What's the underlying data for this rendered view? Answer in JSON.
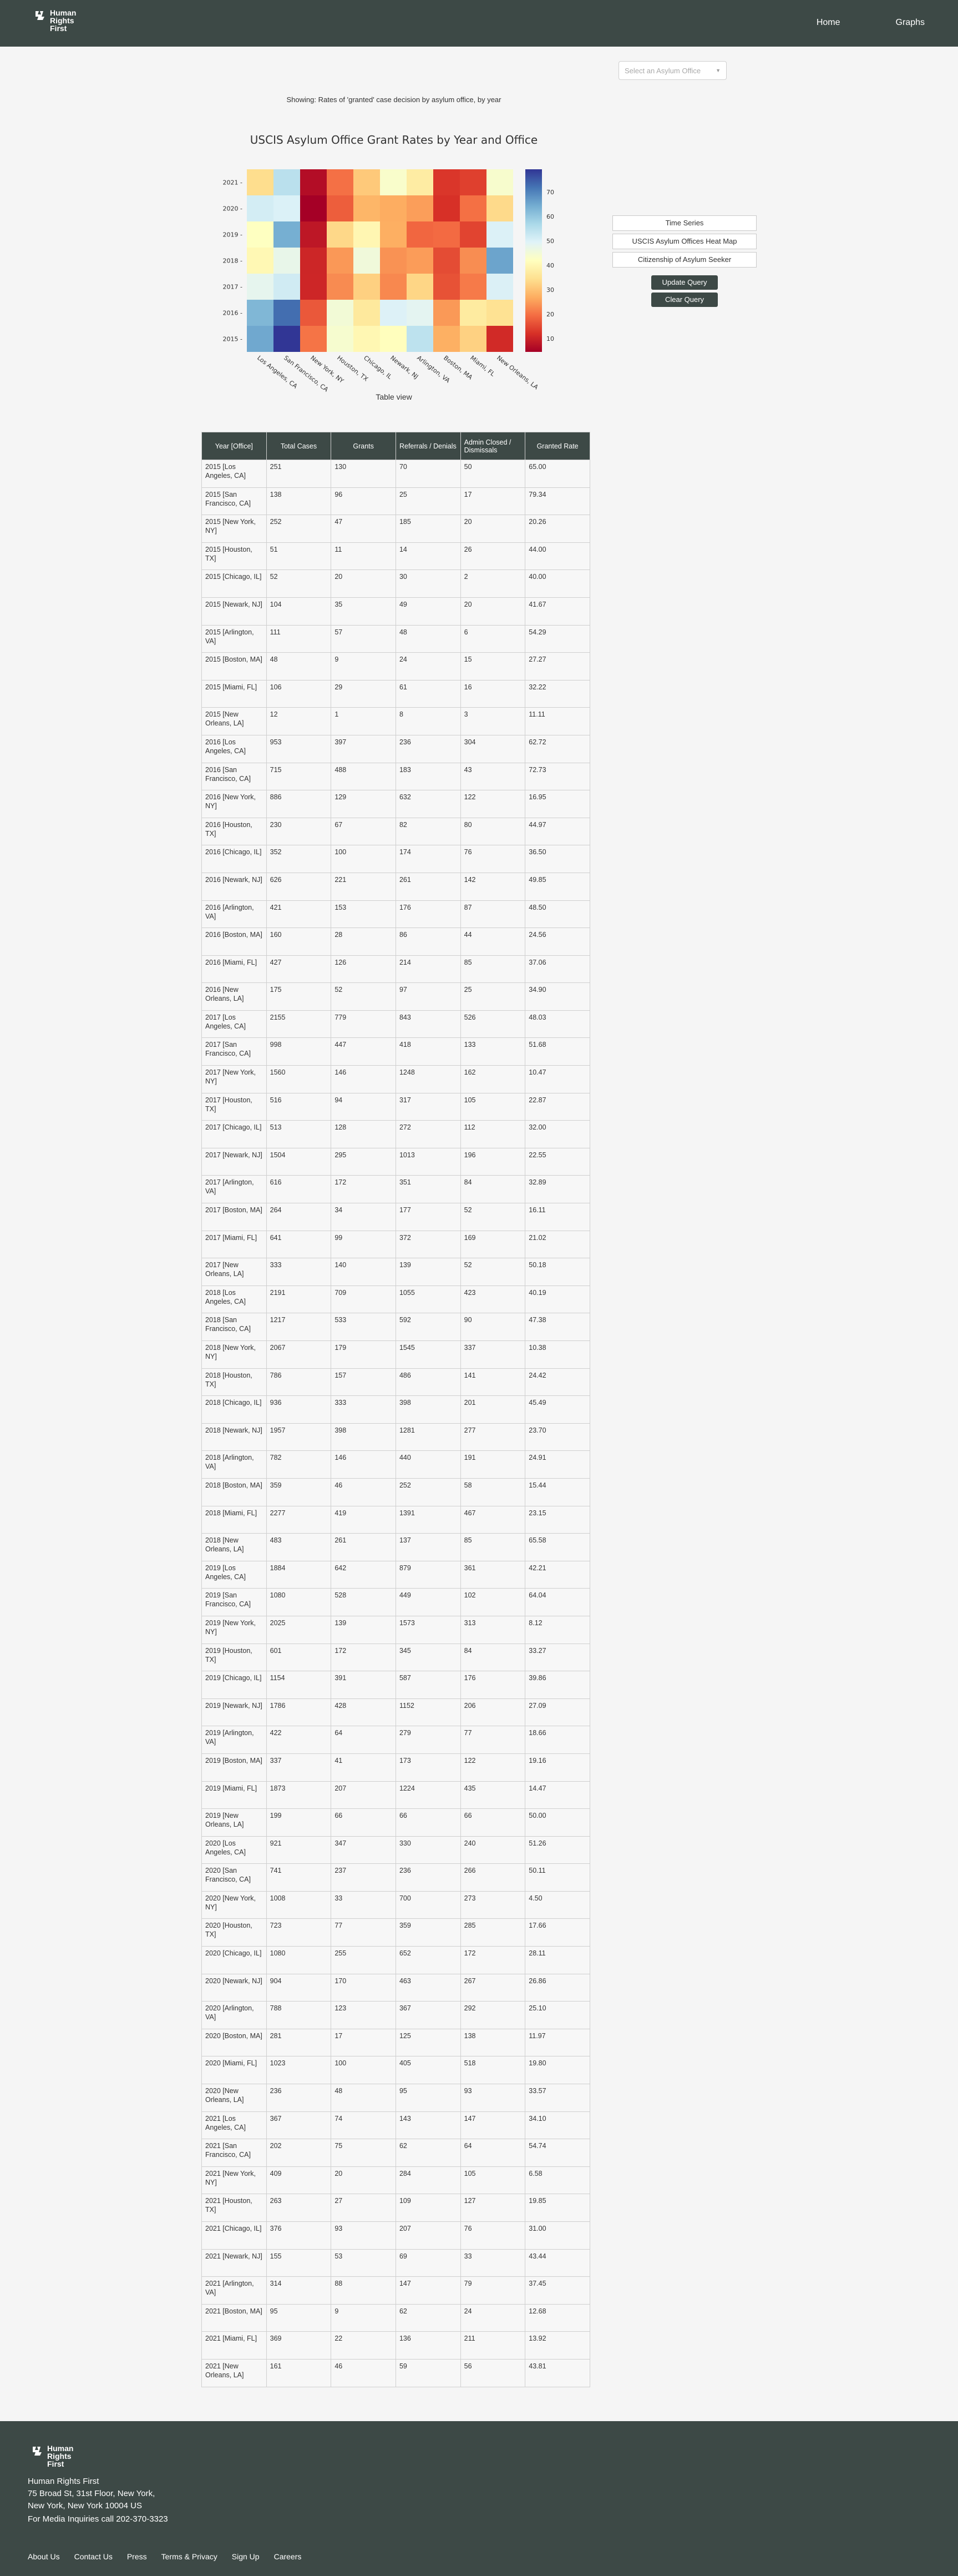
{
  "header": {
    "logo_lines": [
      "Human",
      "Rights",
      "First"
    ],
    "nav": [
      {
        "label": "Home"
      },
      {
        "label": "Graphs"
      }
    ]
  },
  "office_select": {
    "placeholder": "Select an Asylum Office"
  },
  "showing_text": "Showing: Rates of 'granted' case decision by asylum office, by year",
  "side_panel": {
    "options": [
      {
        "label": "Time Series"
      },
      {
        "label": "USCIS Asylum Offices Heat Map"
      },
      {
        "label": "Citizenship of Asylum Seeker"
      }
    ],
    "update_label": "Update Query",
    "clear_label": "Clear Query"
  },
  "table_view_label": "Table view",
  "chart_data": {
    "type": "heatmap",
    "title": "USCIS Asylum Office Grant Rates by Year and Office",
    "x_categories": [
      "Los Angeles, CA",
      "San Francisco, CA",
      "New York, NY",
      "Houston, TX",
      "Chicago, IL",
      "Newark, NJ",
      "Arlington, VA",
      "Boston, MA",
      "Miami, FL",
      "New Orleans, LA"
    ],
    "y_categories": [
      "2021",
      "2020",
      "2019",
      "2018",
      "2017",
      "2016",
      "2015"
    ],
    "values": [
      [
        34.1,
        54.74,
        6.58,
        19.85,
        31.0,
        43.44,
        37.45,
        12.68,
        13.92,
        43.81
      ],
      [
        51.26,
        50.11,
        4.5,
        17.66,
        28.11,
        26.86,
        25.1,
        11.97,
        19.8,
        33.57
      ],
      [
        42.21,
        64.04,
        8.12,
        33.27,
        39.86,
        27.09,
        18.66,
        19.16,
        14.47,
        50.0
      ],
      [
        40.19,
        47.38,
        10.38,
        24.42,
        45.49,
        23.7,
        24.91,
        15.44,
        23.15,
        65.58
      ],
      [
        48.03,
        51.68,
        10.47,
        22.87,
        32.0,
        22.55,
        32.89,
        16.11,
        21.02,
        50.18
      ],
      [
        62.72,
        72.73,
        16.95,
        44.97,
        36.5,
        49.85,
        48.5,
        24.56,
        37.06,
        34.9
      ],
      [
        65.0,
        79.34,
        20.26,
        44.0,
        40.0,
        41.67,
        54.29,
        27.27,
        32.22,
        11.11
      ]
    ],
    "colorbar_ticks": [
      10,
      20,
      30,
      40,
      50,
      60,
      70
    ],
    "zlim": [
      4.5,
      79.34
    ],
    "colorscale": "RdYlBu"
  },
  "table": {
    "headers": [
      "Year [Office]",
      "Total Cases",
      "Grants",
      "Referrals / Denials",
      "Admin Closed / Dismissals",
      "Granted Rate"
    ],
    "rows": [
      [
        "2015 [Los Angeles, CA]",
        "251",
        "130",
        "70",
        "50",
        "65.00"
      ],
      [
        "2015 [San Francisco, CA]",
        "138",
        "96",
        "25",
        "17",
        "79.34"
      ],
      [
        "2015 [New York, NY]",
        "252",
        "47",
        "185",
        "20",
        "20.26"
      ],
      [
        "2015 [Houston, TX]",
        "51",
        "11",
        "14",
        "26",
        "44.00"
      ],
      [
        "2015 [Chicago, IL]",
        "52",
        "20",
        "30",
        "2",
        "40.00"
      ],
      [
        "2015 [Newark, NJ]",
        "104",
        "35",
        "49",
        "20",
        "41.67"
      ],
      [
        "2015 [Arlington, VA]",
        "111",
        "57",
        "48",
        "6",
        "54.29"
      ],
      [
        "2015 [Boston, MA]",
        "48",
        "9",
        "24",
        "15",
        "27.27"
      ],
      [
        "2015 [Miami, FL]",
        "106",
        "29",
        "61",
        "16",
        "32.22"
      ],
      [
        "2015 [New Orleans, LA]",
        "12",
        "1",
        "8",
        "3",
        "11.11"
      ],
      [
        "2016 [Los Angeles, CA]",
        "953",
        "397",
        "236",
        "304",
        "62.72"
      ],
      [
        "2016 [San Francisco, CA]",
        "715",
        "488",
        "183",
        "43",
        "72.73"
      ],
      [
        "2016 [New York, NY]",
        "886",
        "129",
        "632",
        "122",
        "16.95"
      ],
      [
        "2016 [Houston, TX]",
        "230",
        "67",
        "82",
        "80",
        "44.97"
      ],
      [
        "2016 [Chicago, IL]",
        "352",
        "100",
        "174",
        "76",
        "36.50"
      ],
      [
        "2016 [Newark, NJ]",
        "626",
        "221",
        "261",
        "142",
        "49.85"
      ],
      [
        "2016 [Arlington, VA]",
        "421",
        "153",
        "176",
        "87",
        "48.50"
      ],
      [
        "2016 [Boston, MA]",
        "160",
        "28",
        "86",
        "44",
        "24.56"
      ],
      [
        "2016 [Miami, FL]",
        "427",
        "126",
        "214",
        "85",
        "37.06"
      ],
      [
        "2016 [New Orleans, LA]",
        "175",
        "52",
        "97",
        "25",
        "34.90"
      ],
      [
        "2017 [Los Angeles, CA]",
        "2155",
        "779",
        "843",
        "526",
        "48.03"
      ],
      [
        "2017 [San Francisco, CA]",
        "998",
        "447",
        "418",
        "133",
        "51.68"
      ],
      [
        "2017 [New York, NY]",
        "1560",
        "146",
        "1248",
        "162",
        "10.47"
      ],
      [
        "2017 [Houston, TX]",
        "516",
        "94",
        "317",
        "105",
        "22.87"
      ],
      [
        "2017 [Chicago, IL]",
        "513",
        "128",
        "272",
        "112",
        "32.00"
      ],
      [
        "2017 [Newark, NJ]",
        "1504",
        "295",
        "1013",
        "196",
        "22.55"
      ],
      [
        "2017 [Arlington, VA]",
        "616",
        "172",
        "351",
        "84",
        "32.89"
      ],
      [
        "2017 [Boston, MA]",
        "264",
        "34",
        "177",
        "52",
        "16.11"
      ],
      [
        "2017 [Miami, FL]",
        "641",
        "99",
        "372",
        "169",
        "21.02"
      ],
      [
        "2017 [New Orleans, LA]",
        "333",
        "140",
        "139",
        "52",
        "50.18"
      ],
      [
        "2018 [Los Angeles, CA]",
        "2191",
        "709",
        "1055",
        "423",
        "40.19"
      ],
      [
        "2018 [San Francisco, CA]",
        "1217",
        "533",
        "592",
        "90",
        "47.38"
      ],
      [
        "2018 [New York, NY]",
        "2067",
        "179",
        "1545",
        "337",
        "10.38"
      ],
      [
        "2018 [Houston, TX]",
        "786",
        "157",
        "486",
        "141",
        "24.42"
      ],
      [
        "2018 [Chicago, IL]",
        "936",
        "333",
        "398",
        "201",
        "45.49"
      ],
      [
        "2018 [Newark, NJ]",
        "1957",
        "398",
        "1281",
        "277",
        "23.70"
      ],
      [
        "2018 [Arlington, VA]",
        "782",
        "146",
        "440",
        "191",
        "24.91"
      ],
      [
        "2018 [Boston, MA]",
        "359",
        "46",
        "252",
        "58",
        "15.44"
      ],
      [
        "2018 [Miami, FL]",
        "2277",
        "419",
        "1391",
        "467",
        "23.15"
      ],
      [
        "2018 [New Orleans, LA]",
        "483",
        "261",
        "137",
        "85",
        "65.58"
      ],
      [
        "2019 [Los Angeles, CA]",
        "1884",
        "642",
        "879",
        "361",
        "42.21"
      ],
      [
        "2019 [San Francisco, CA]",
        "1080",
        "528",
        "449",
        "102",
        "64.04"
      ],
      [
        "2019 [New York, NY]",
        "2025",
        "139",
        "1573",
        "313",
        "8.12"
      ],
      [
        "2019 [Houston, TX]",
        "601",
        "172",
        "345",
        "84",
        "33.27"
      ],
      [
        "2019 [Chicago, IL]",
        "1154",
        "391",
        "587",
        "176",
        "39.86"
      ],
      [
        "2019 [Newark, NJ]",
        "1786",
        "428",
        "1152",
        "206",
        "27.09"
      ],
      [
        "2019 [Arlington, VA]",
        "422",
        "64",
        "279",
        "77",
        "18.66"
      ],
      [
        "2019 [Boston, MA]",
        "337",
        "41",
        "173",
        "122",
        "19.16"
      ],
      [
        "2019 [Miami, FL]",
        "1873",
        "207",
        "1224",
        "435",
        "14.47"
      ],
      [
        "2019 [New Orleans, LA]",
        "199",
        "66",
        "66",
        "66",
        "50.00"
      ],
      [
        "2020 [Los Angeles, CA]",
        "921",
        "347",
        "330",
        "240",
        "51.26"
      ],
      [
        "2020 [San Francisco, CA]",
        "741",
        "237",
        "236",
        "266",
        "50.11"
      ],
      [
        "2020 [New York, NY]",
        "1008",
        "33",
        "700",
        "273",
        "4.50"
      ],
      [
        "2020 [Houston, TX]",
        "723",
        "77",
        "359",
        "285",
        "17.66"
      ],
      [
        "2020 [Chicago, IL]",
        "1080",
        "255",
        "652",
        "172",
        "28.11"
      ],
      [
        "2020 [Newark, NJ]",
        "904",
        "170",
        "463",
        "267",
        "26.86"
      ],
      [
        "2020 [Arlington, VA]",
        "788",
        "123",
        "367",
        "292",
        "25.10"
      ],
      [
        "2020 [Boston, MA]",
        "281",
        "17",
        "125",
        "138",
        "11.97"
      ],
      [
        "2020 [Miami, FL]",
        "1023",
        "100",
        "405",
        "518",
        "19.80"
      ],
      [
        "2020 [New Orleans, LA]",
        "236",
        "48",
        "95",
        "93",
        "33.57"
      ],
      [
        "2021 [Los Angeles, CA]",
        "367",
        "74",
        "143",
        "147",
        "34.10"
      ],
      [
        "2021 [San Francisco, CA]",
        "202",
        "75",
        "62",
        "64",
        "54.74"
      ],
      [
        "2021 [New York, NY]",
        "409",
        "20",
        "284",
        "105",
        "6.58"
      ],
      [
        "2021 [Houston, TX]",
        "263",
        "27",
        "109",
        "127",
        "19.85"
      ],
      [
        "2021 [Chicago, IL]",
        "376",
        "93",
        "207",
        "76",
        "31.00"
      ],
      [
        "2021 [Newark, NJ]",
        "155",
        "53",
        "69",
        "33",
        "43.44"
      ],
      [
        "2021 [Arlington, VA]",
        "314",
        "88",
        "147",
        "79",
        "37.45"
      ],
      [
        "2021 [Boston, MA]",
        "95",
        "9",
        "62",
        "24",
        "12.68"
      ],
      [
        "2021 [Miami, FL]",
        "369",
        "22",
        "136",
        "211",
        "13.92"
      ],
      [
        "2021 [New Orleans, LA]",
        "161",
        "46",
        "59",
        "56",
        "43.81"
      ]
    ]
  },
  "footer": {
    "logo_lines": [
      "Human",
      "Rights",
      "First"
    ],
    "org_name": "Human Rights First",
    "address_line1": "75 Broad St, 31st Floor, New York,",
    "address_line2": "New York, New York 10004 US",
    "media": "For Media Inquiries call 202-370-3323",
    "links": [
      {
        "label": "About Us"
      },
      {
        "label": "Contact Us"
      },
      {
        "label": "Press"
      },
      {
        "label": "Terms & Privacy"
      },
      {
        "label": "Sign Up"
      },
      {
        "label": "Careers"
      }
    ]
  },
  "colors": {
    "brand_dark": "#3d4946",
    "background": "#f5f5f5"
  }
}
